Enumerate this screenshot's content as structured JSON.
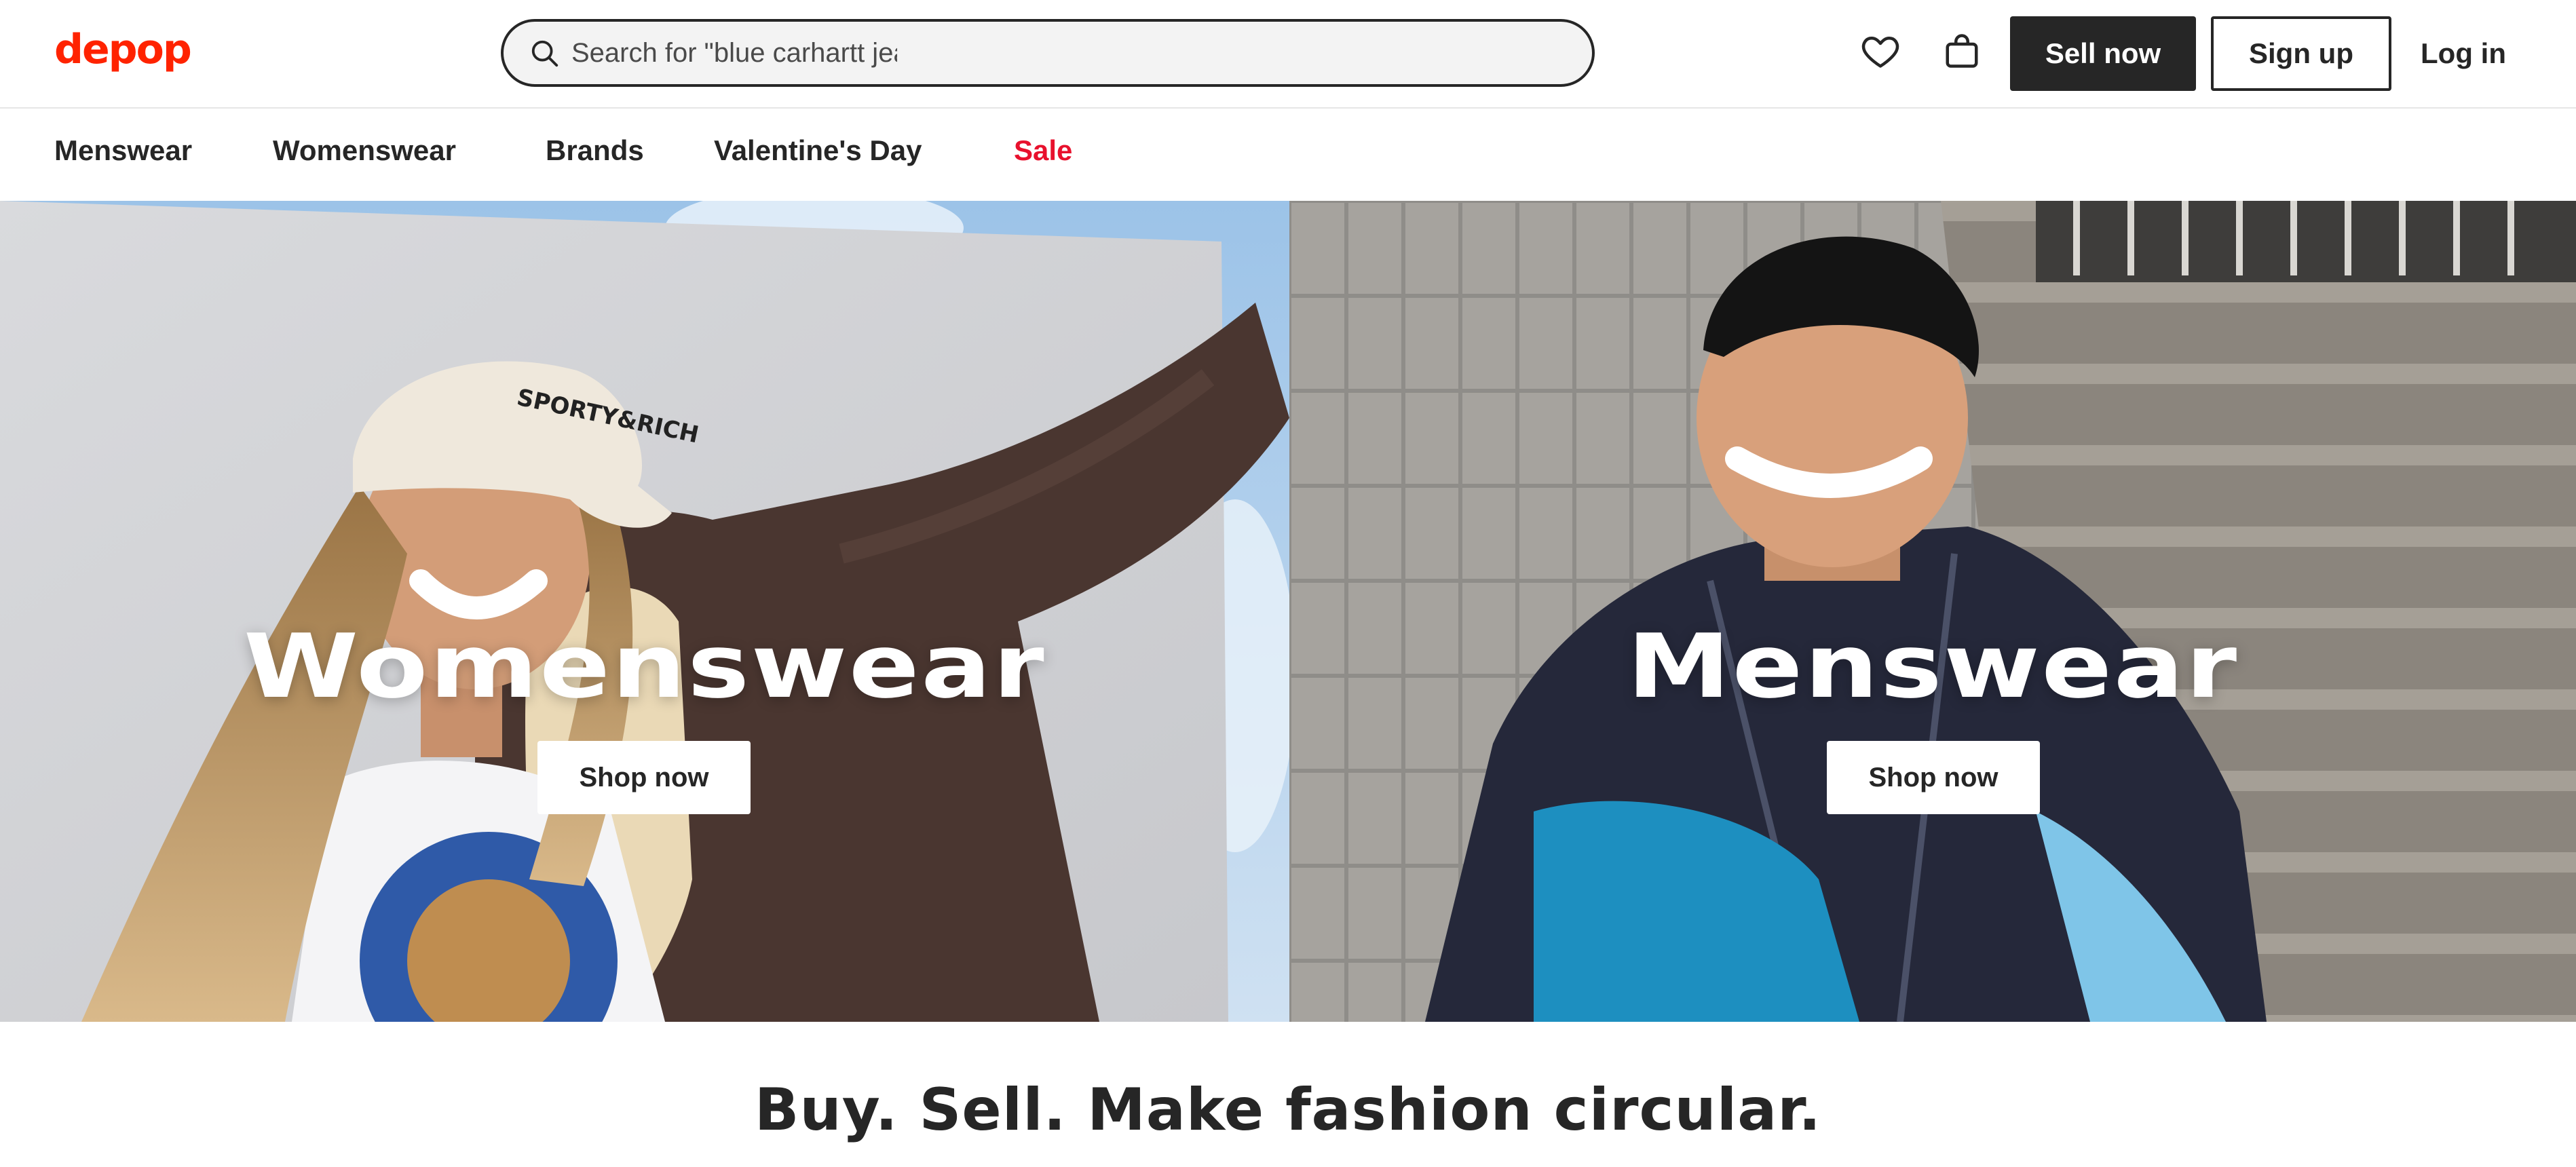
{
  "header": {
    "logo_text": "depop",
    "search": {
      "placeholder": "Search for \"blue carhartt jea",
      "icon": "search-icon"
    },
    "icons": [
      "heart-icon",
      "shopping-bag-icon"
    ],
    "sell_label": "Sell now",
    "signup_label": "Sign up",
    "login_label": "Log in"
  },
  "nav": {
    "items": [
      {
        "label": "Menswear"
      },
      {
        "label": "Womenswear"
      },
      {
        "label": "Brands"
      },
      {
        "label": "Valentine's Day"
      },
      {
        "label": "Sale",
        "color": "#e8112d"
      }
    ]
  },
  "hero": {
    "left": {
      "title": "Womenswear",
      "button": "Shop now"
    },
    "right": {
      "title": "Menswear",
      "button": "Shop now"
    }
  },
  "tagline": "Buy. Sell. Make fashion circular.",
  "colors": {
    "brand": "#ff2300",
    "text": "#262626",
    "sale": "#e8112d",
    "border": "#e6e6e6"
  }
}
